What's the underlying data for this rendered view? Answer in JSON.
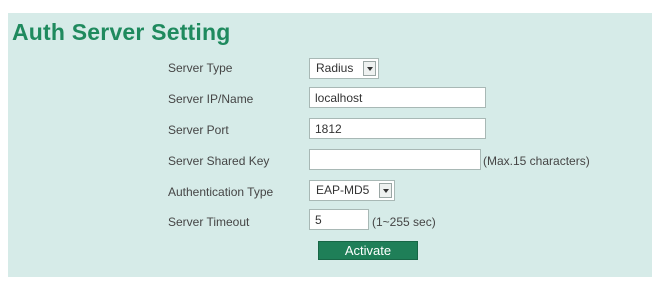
{
  "page_title": "Auth Server Setting",
  "fields": {
    "server_type": {
      "label": "Server Type",
      "value": "Radius"
    },
    "server_ip": {
      "label": "Server IP/Name",
      "value": "localhost"
    },
    "server_port": {
      "label": "Server Port",
      "value": "1812"
    },
    "shared_key": {
      "label": "Server Shared Key",
      "value": "",
      "hint": "(Max.15 characters)"
    },
    "auth_type": {
      "label": "Authentication Type",
      "value": "EAP-MD5"
    },
    "timeout": {
      "label": "Server Timeout",
      "value": "5",
      "hint": "(1~255 sec)"
    }
  },
  "buttons": {
    "activate": "Activate"
  },
  "colors": {
    "panel_background": "#d6ebe8",
    "title": "#1f8a5e",
    "button": "#1f7f58"
  }
}
